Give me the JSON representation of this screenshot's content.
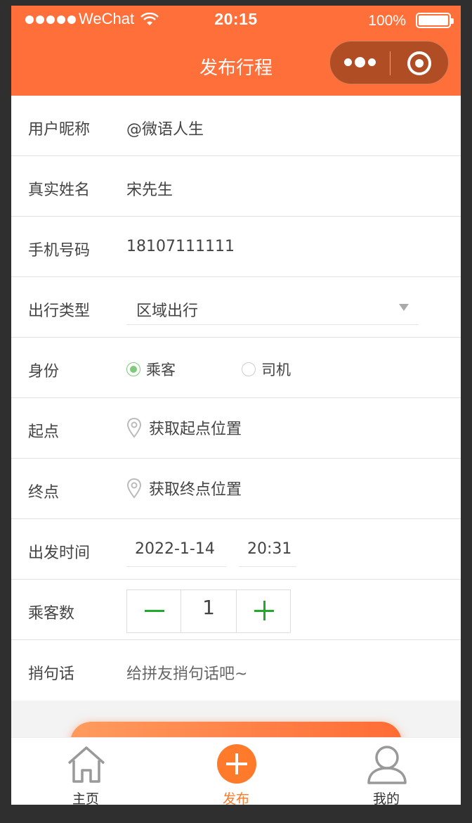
{
  "status_bar": {
    "carrier": "WeChat",
    "time": "20:15",
    "battery": "100%"
  },
  "nav": {
    "title": "发布行程"
  },
  "form": {
    "nickname": {
      "label": "用户昵称",
      "value": "@微语人生"
    },
    "real_name": {
      "label": "真实姓名",
      "value": "宋先生"
    },
    "phone": {
      "label": "手机号码",
      "value": "18107111111"
    },
    "trip_type": {
      "label": "出行类型",
      "selected": "区域出行"
    },
    "identity": {
      "label": "身份",
      "options": [
        "乘客",
        "司机"
      ],
      "selected": "乘客"
    },
    "start": {
      "label": "起点",
      "value": "获取起点位置"
    },
    "end": {
      "label": "终点",
      "value": "获取终点位置"
    },
    "depart": {
      "label": "出发时间",
      "date": "2022-1-14",
      "time": "20:31"
    },
    "passengers": {
      "label": "乘客数",
      "value": "1"
    },
    "message": {
      "label": "捎句话",
      "placeholder": "给拼友捎句话吧~"
    }
  },
  "tabbar": {
    "items": [
      {
        "label": "主页",
        "icon": "home-icon"
      },
      {
        "label": "发布",
        "icon": "plus-circle-icon",
        "active": true
      },
      {
        "label": "我的",
        "icon": "user-icon"
      }
    ]
  },
  "colors": {
    "brand": "#ff6f3a",
    "active_tab": "#ff7a2a",
    "stepper_green": "#22a82a",
    "radio_green": "#7fc97a"
  }
}
